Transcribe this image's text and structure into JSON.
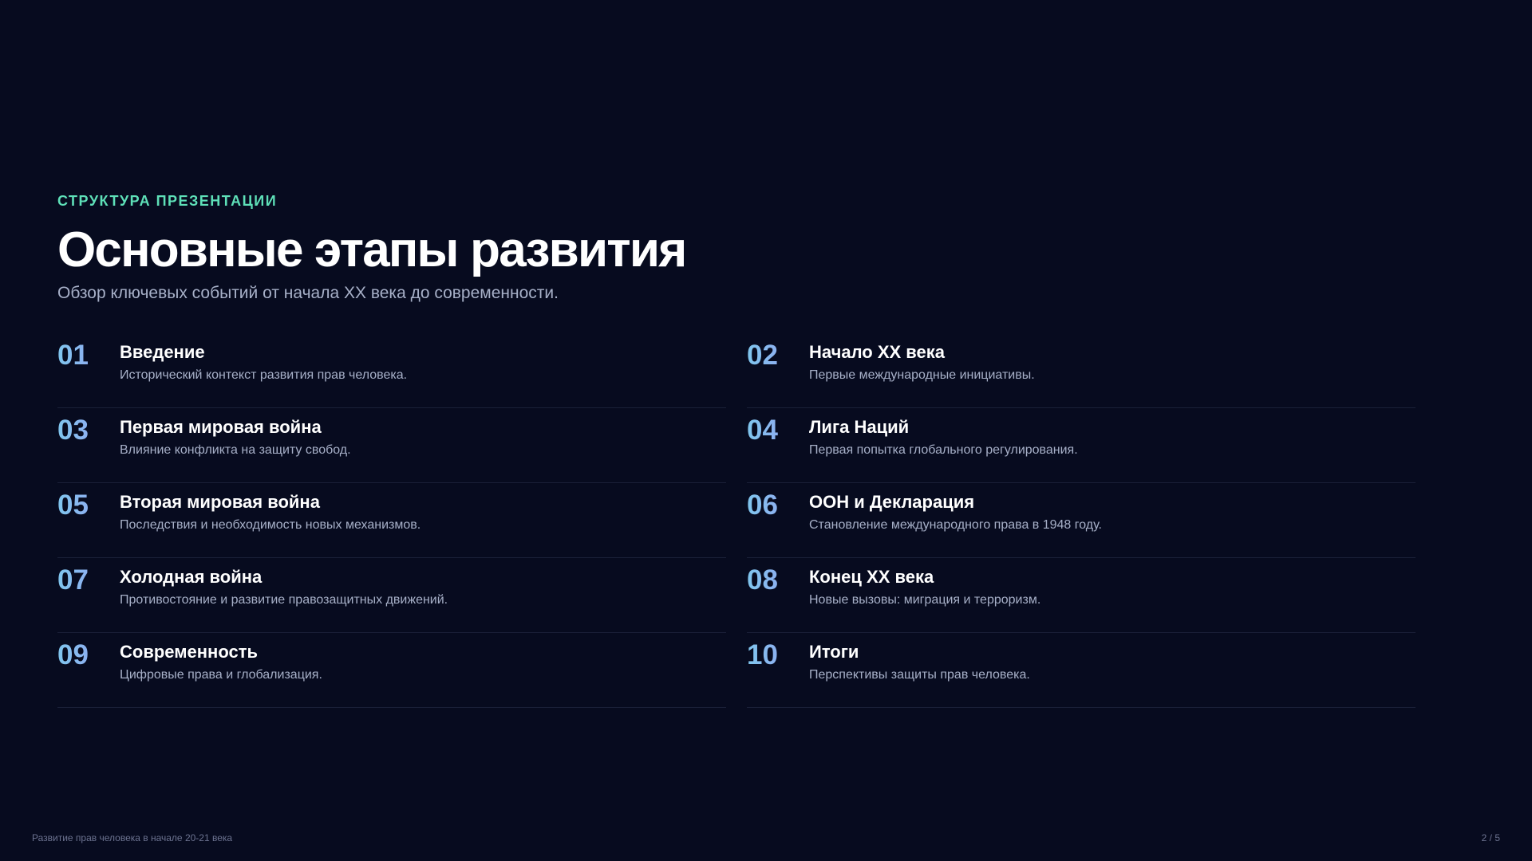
{
  "header": {
    "kicker": "СТРУКТУРА ПРЕЗЕНТАЦИИ",
    "title": "Основные этапы развития",
    "subtitle": "Обзор ключевых событий от начала XX века до современности."
  },
  "items": [
    {
      "num": "01",
      "title": "Введение",
      "desc": "Исторический контекст развития прав человека."
    },
    {
      "num": "02",
      "title": "Начало XX века",
      "desc": "Первые международные инициативы."
    },
    {
      "num": "03",
      "title": "Первая мировая война",
      "desc": "Влияние конфликта на защиту свобод."
    },
    {
      "num": "04",
      "title": "Лига Наций",
      "desc": "Первая попытка глобального регулирования."
    },
    {
      "num": "05",
      "title": "Вторая мировая война",
      "desc": "Последствия и необходимость новых механизмов."
    },
    {
      "num": "06",
      "title": "ООН и Декларация",
      "desc": "Становление международного права в 1948 году."
    },
    {
      "num": "07",
      "title": "Холодная война",
      "desc": "Противостояние и развитие правозащитных движений."
    },
    {
      "num": "08",
      "title": "Конец XX века",
      "desc": "Новые вызовы: миграция и терроризм."
    },
    {
      "num": "09",
      "title": "Современность",
      "desc": "Цифровые права и глобализация."
    },
    {
      "num": "10",
      "title": "Итоги",
      "desc": "Перспективы защиты прав человека."
    }
  ],
  "footer": {
    "left": "Развитие прав человека в начале 20-21 века",
    "page": "2 / 5"
  },
  "colors": {
    "background": "#070b1f",
    "accent": "#5ee0b8",
    "number_gradient_start": "#7fc6ee",
    "number_gradient_end": "#9a9cf2"
  }
}
